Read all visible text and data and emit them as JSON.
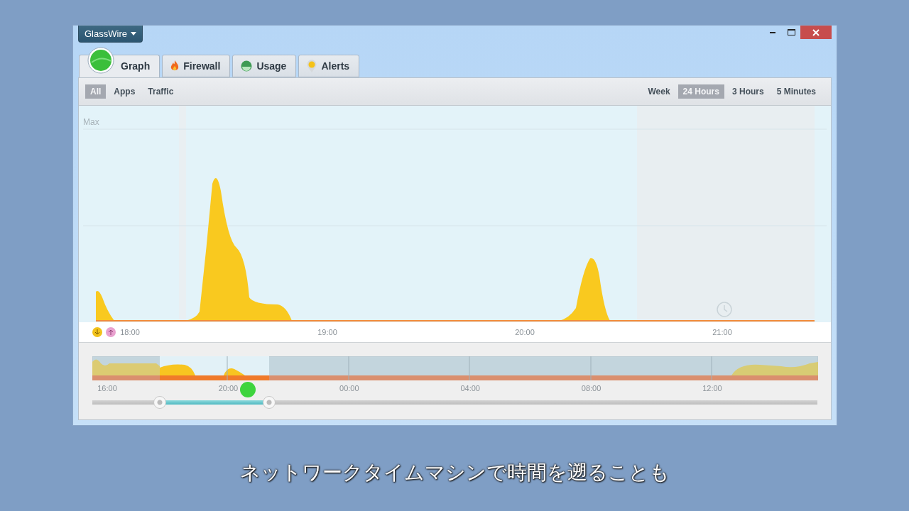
{
  "window": {
    "title": "GlassWire"
  },
  "tabs": [
    {
      "label": "Graph",
      "kind": "graph",
      "selected": true
    },
    {
      "label": "Firewall",
      "kind": "firewall",
      "selected": false
    },
    {
      "label": "Usage",
      "kind": "usage",
      "selected": false
    },
    {
      "label": "Alerts",
      "kind": "alerts",
      "selected": false
    }
  ],
  "filters": [
    {
      "label": "All",
      "selected": true
    },
    {
      "label": "Apps",
      "selected": false
    },
    {
      "label": "Traffic",
      "selected": false
    }
  ],
  "time_ranges": [
    {
      "label": "Week",
      "selected": false
    },
    {
      "label": "24 Hours",
      "selected": true
    },
    {
      "label": "3 Hours",
      "selected": false
    },
    {
      "label": "5 Minutes",
      "selected": false
    }
  ],
  "graph": {
    "max_label": "Max",
    "axis_labels": [
      "18:00",
      "19:00",
      "20:00",
      "21:00"
    ]
  },
  "overview": {
    "axis_labels": [
      "16:00",
      "20:00",
      "00:00",
      "04:00",
      "08:00",
      "12:00"
    ],
    "handles": [
      {
        "level": 0.093
      },
      {
        "level": 0.244
      }
    ]
  },
  "subtitle": "ネットワークタイムマシンで時間を遡ることも"
}
